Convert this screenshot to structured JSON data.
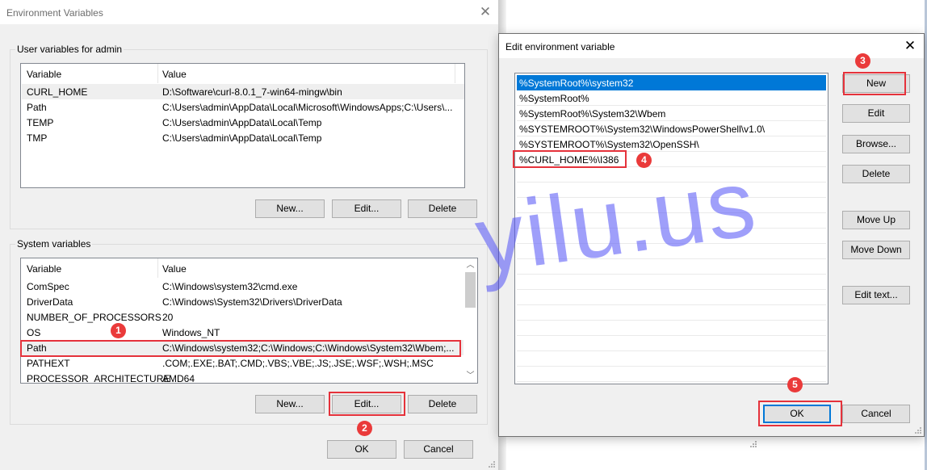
{
  "env_dialog": {
    "title": "Environment Variables",
    "close_icon": "close-icon",
    "user_group": {
      "label": "User variables for admin",
      "columns": [
        "Variable",
        "Value"
      ],
      "rows": [
        {
          "variable": "CURL_HOME",
          "value": "D:\\Software\\curl-8.0.1_7-win64-mingw\\bin",
          "selected": true
        },
        {
          "variable": "Path",
          "value": "C:\\Users\\admin\\AppData\\Local\\Microsoft\\WindowsApps;C:\\Users\\..."
        },
        {
          "variable": "TEMP",
          "value": "C:\\Users\\admin\\AppData\\Local\\Temp"
        },
        {
          "variable": "TMP",
          "value": "C:\\Users\\admin\\AppData\\Local\\Temp"
        }
      ],
      "buttons": {
        "new": "New...",
        "edit": "Edit...",
        "delete": "Delete"
      }
    },
    "system_group": {
      "label": "System variables",
      "columns": [
        "Variable",
        "Value"
      ],
      "rows": [
        {
          "variable": "ComSpec",
          "value": "C:\\Windows\\system32\\cmd.exe"
        },
        {
          "variable": "DriverData",
          "value": "C:\\Windows\\System32\\Drivers\\DriverData"
        },
        {
          "variable": "NUMBER_OF_PROCESSORS",
          "value": "20"
        },
        {
          "variable": "OS",
          "value": "Windows_NT"
        },
        {
          "variable": "Path",
          "value": "C:\\Windows\\system32;C:\\Windows;C:\\Windows\\System32\\Wbem;...",
          "selected": true
        },
        {
          "variable": "PATHEXT",
          "value": ".COM;.EXE;.BAT;.CMD;.VBS;.VBE;.JS;.JSE;.WSF;.WSH;.MSC"
        },
        {
          "variable": "PROCESSOR_ARCHITECTURE",
          "value": "AMD64"
        }
      ],
      "buttons": {
        "new": "New...",
        "edit": "Edit...",
        "delete": "Delete"
      }
    },
    "footer_buttons": {
      "ok": "OK",
      "cancel": "Cancel"
    }
  },
  "edit_dialog": {
    "title": "Edit environment variable",
    "close_icon": "close-icon",
    "entries": [
      {
        "text": "%SystemRoot%\\system32",
        "selected": true
      },
      {
        "text": "%SystemRoot%"
      },
      {
        "text": "%SystemRoot%\\System32\\Wbem"
      },
      {
        "text": "%SYSTEMROOT%\\System32\\WindowsPowerShell\\v1.0\\"
      },
      {
        "text": "%SYSTEMROOT%\\System32\\OpenSSH\\"
      },
      {
        "text": "%CURL_HOME%\\I386"
      }
    ],
    "side_buttons": {
      "new": "New",
      "edit": "Edit",
      "browse": "Browse...",
      "delete": "Delete",
      "move_up": "Move Up",
      "move_down": "Move Down",
      "edit_text": "Edit text..."
    },
    "footer_buttons": {
      "ok": "OK",
      "cancel": "Cancel"
    }
  },
  "annotations": {
    "step1": "1",
    "step2": "2",
    "step3": "3",
    "step4": "4",
    "step5": "5",
    "color": "#ea3a3a"
  },
  "watermark": "yilu.us"
}
